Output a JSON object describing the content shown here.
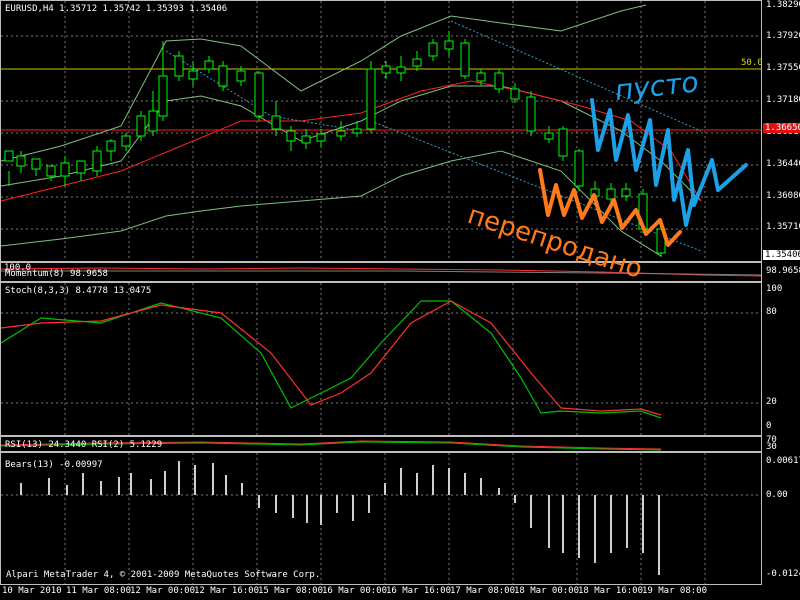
{
  "main": {
    "header": "EURUSD,H4  1.35712 1.35742 1.35393 1.35406",
    "level_label": "50.0",
    "current_price_tag": "1.35406",
    "red_price_tag": "1.36650",
    "axis_ticks": [
      "1.38290",
      "1.37920",
      "1.37550",
      "1.37180",
      "1.36810",
      "1.36440",
      "1.36080",
      "1.35710"
    ]
  },
  "momentum": {
    "header": "Momentum(8) 98.9658",
    "axis_top": "100.0",
    "axis_value": "98.9658"
  },
  "stoch": {
    "header": "Stoch(8,3,3) 8.4778 13.0475",
    "axis_ticks": [
      "100",
      "80",
      "20",
      "0"
    ]
  },
  "rsi": {
    "header": "RSI(13) 24.3440  RSI(2) 5.1229",
    "axis_ticks": [
      "70",
      "30"
    ]
  },
  "bears": {
    "header": "Bears(13) -0.00997",
    "axis_ticks": [
      "0.00617",
      "0.00",
      "-0.01247"
    ]
  },
  "copyright": "Alpari MetaTrader 4, © 2001-2009 MetaQuotes Software Corp.",
  "dates": [
    "10 Mar 2010",
    "11 Mar 08:00",
    "12 Mar 00:00",
    "12 Mar 16:00",
    "15 Mar 08:00",
    "16 Mar 00:00",
    "16 Mar 16:00",
    "17 Mar 08:00",
    "18 Mar 00:00",
    "18 Mar 16:00",
    "19 Mar 08:00"
  ],
  "annotations": {
    "blue_text": "пусто",
    "orange_text": "перепродано"
  },
  "colors": {
    "bull": "#ffffff",
    "bear": "#000000",
    "candle_edge": "#00ff00",
    "band": "#7fbf7f",
    "ma": "#ff2020",
    "level": "#c8c800",
    "annot_blue": "#1ea0e6",
    "annot_orange": "#ff7a1a"
  }
}
